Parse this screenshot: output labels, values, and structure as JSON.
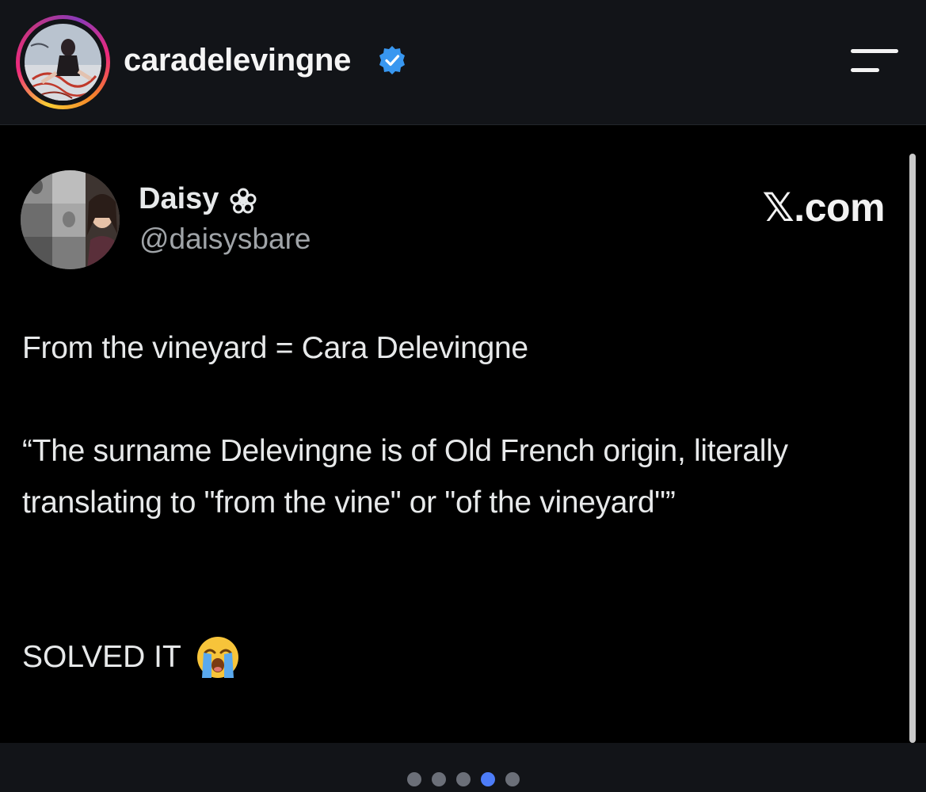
{
  "header": {
    "username": "caradelevingne",
    "verified_icon": "verified-badge-icon",
    "menu_icon": "hamburger-menu-icon"
  },
  "tweet": {
    "display_name": "Daisy",
    "name_icon": "flower-icon",
    "handle": "@daisysbare",
    "source": "𝕏.com",
    "line1": "From the vineyard = Cara Delevingne",
    "quote": "“The surname Delevingne is of Old French origin, literally translating to \"from the vine\" or \"of the vineyard\"”",
    "solved": "SOLVED IT",
    "emoji_icon": "loudly-crying-face-icon"
  },
  "pagination": {
    "total": 5,
    "active_index": 3
  },
  "colors": {
    "background": "#121418",
    "post_background": "#000000",
    "active_dot": "#4d7cf7",
    "inactive_dot": "#6b6f78",
    "verified": "#3897f0"
  }
}
